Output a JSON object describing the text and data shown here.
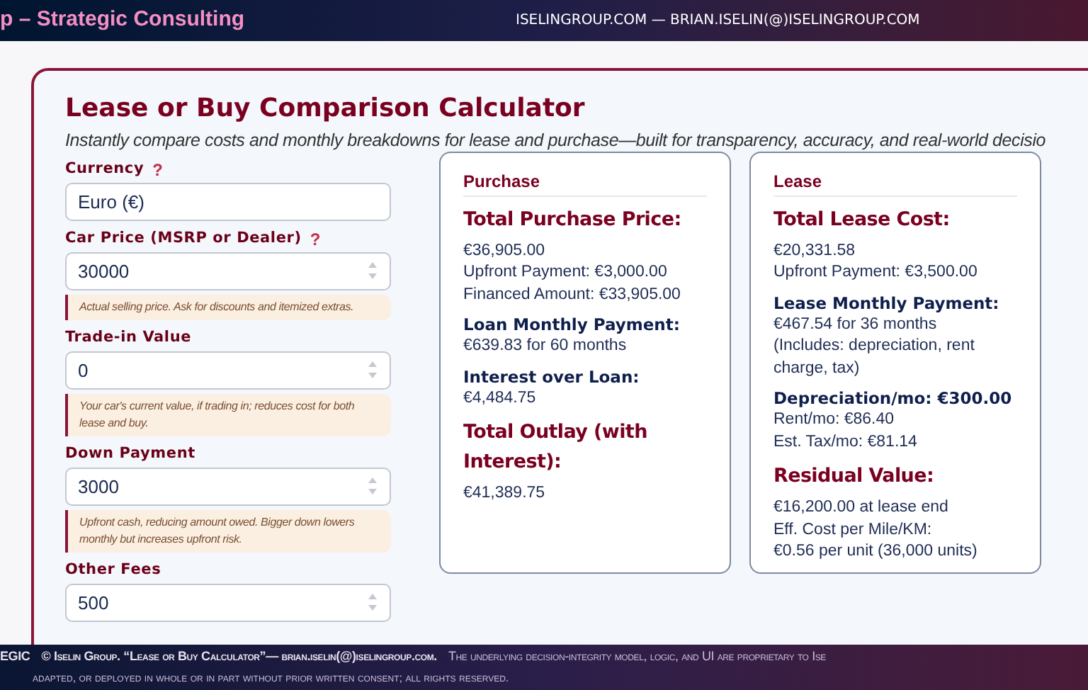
{
  "header": {
    "brand": "p – Strategic Consulting",
    "contact": "ISELINGROUP.COM — BRIAN.ISELIN(@)ISELINGROUP.COM"
  },
  "calculator": {
    "title": "Lease or Buy Comparison Calculator",
    "subtitle": "Instantly compare costs and monthly breakdowns for lease and purchase—built for transparency, accuracy, and real-world decisio",
    "fields": [
      {
        "label": "Currency",
        "help": "?",
        "kind": "select",
        "value": "Euro (€)"
      },
      {
        "label": "Car Price (MSRP or Dealer)",
        "help": "?",
        "kind": "number",
        "value": "30000",
        "hint": "Actual selling price. Ask for discounts and itemized extras."
      },
      {
        "label": "Trade-in Value",
        "kind": "number",
        "value": "0",
        "hint": "Your car's current value, if trading in; reduces cost for both lease and buy."
      },
      {
        "label": "Down Payment",
        "kind": "number",
        "value": "3000",
        "hint": "Upfront cash, reducing amount owed. Bigger down lowers monthly but increases upfront risk."
      },
      {
        "label": "Other Fees",
        "kind": "number",
        "value": "500"
      }
    ],
    "results": [
      {
        "title": "Purchase",
        "lines": [
          {
            "kind": "heading",
            "text": "Total Purchase Price:"
          },
          {
            "kind": "text",
            "text": "€36,905.00"
          },
          {
            "kind": "text",
            "text": "Upfront Payment: €3,000.00"
          },
          {
            "kind": "text",
            "text": "Financed Amount: €33,905.00"
          },
          {
            "kind": "label",
            "text": "Loan Monthly Payment:"
          },
          {
            "kind": "text",
            "text": "€639.83 for 60 months"
          },
          {
            "kind": "label",
            "text": "Interest over Loan:"
          },
          {
            "kind": "text",
            "text": "€4,484.75"
          },
          {
            "kind": "heading",
            "text": "Total Outlay (with Interest):"
          },
          {
            "kind": "text",
            "text": "€41,389.75"
          }
        ]
      },
      {
        "title": "Lease",
        "lines": [
          {
            "kind": "heading",
            "text": "Total Lease Cost:"
          },
          {
            "kind": "text",
            "text": "€20,331.58"
          },
          {
            "kind": "text",
            "text": "Upfront Payment: €3,500.00"
          },
          {
            "kind": "label",
            "text": "Lease Monthly Payment:"
          },
          {
            "kind": "text",
            "text": "€467.54 for 36 months"
          },
          {
            "kind": "text",
            "text": "(Includes: depreciation, rent charge, tax)"
          },
          {
            "kind": "label",
            "text": "Depreciation/mo: €300.00"
          },
          {
            "kind": "text",
            "text": "Rent/mo: €86.40"
          },
          {
            "kind": "text",
            "text": "Est. Tax/mo: €81.14"
          },
          {
            "kind": "heading",
            "text": "Residual Value:"
          },
          {
            "kind": "text",
            "text": "€16,200.00 at lease end"
          },
          {
            "kind": "text",
            "text": "Eff. Cost per Mile/KM:"
          },
          {
            "kind": "text",
            "text": "€0.56 per unit (36,000 units)"
          }
        ]
      }
    ]
  },
  "footer": {
    "lines": [
      "EGIC",
      "© Iselin Group. “Lease or Buy Calculator”— brian.iselin(@)iselingroup.com.",
      "The underlying decision-integrity model, logic, and UI are proprietary to Ise",
      "adapted, or deployed in whole or in part without prior written consent; all rights reserved."
    ]
  }
}
